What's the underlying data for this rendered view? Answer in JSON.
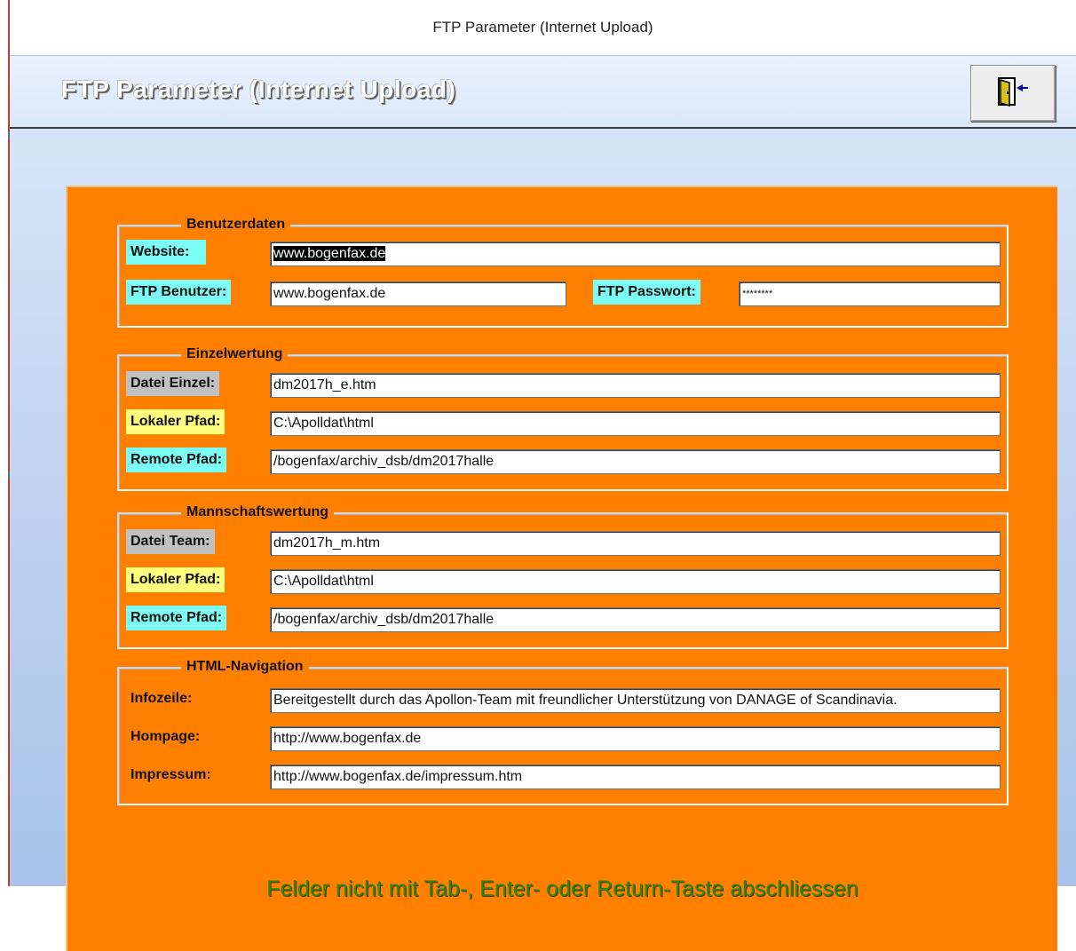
{
  "window": {
    "title": "FTP Parameter (Internet Upload)"
  },
  "header": {
    "title": "FTP Parameter (Internet Upload)",
    "exit_icon": "door-exit-icon"
  },
  "colors": {
    "panel": "#ff8000",
    "label_cyan": "#7bfcf4",
    "label_gray": "#c1c1c1",
    "label_yellow": "#ffff7d",
    "notice_text": "#2a8a00"
  },
  "benutzerdaten": {
    "legend": "Benutzerdaten",
    "website_label": "Website:",
    "website_value": "www.bogenfax.de",
    "ftp_user_label": "FTP Benutzer:",
    "ftp_user_value": "www.bogenfax.de",
    "ftp_password_label": "FTP Passwort:",
    "ftp_password_value": "********"
  },
  "einzelwertung": {
    "legend": "Einzelwertung",
    "file_label": "Datei Einzel:",
    "file_value": "dm2017h_e.htm",
    "local_label": "Lokaler Pfad:",
    "local_value": "C:\\Apolldat\\html",
    "remote_label": "Remote Pfad:",
    "remote_value": "/bogenfax/archiv_dsb/dm2017halle"
  },
  "mannschaftswertung": {
    "legend": "Mannschaftswertung",
    "file_label": "Datei Team:",
    "file_value": "dm2017h_m.htm",
    "local_label": "Lokaler Pfad:",
    "local_value": "C:\\Apolldat\\html",
    "remote_label": "Remote Pfad:",
    "remote_value": "/bogenfax/archiv_dsb/dm2017halle"
  },
  "navigation": {
    "legend": "HTML-Navigation",
    "info_label": "Infozeile:",
    "info_value": "Bereitgestellt durch das Apollon-Team mit freundlicher Unterstützung von DANAGE of Scandinavia.",
    "homepage_label": "Hompage:",
    "homepage_value": "http://www.bogenfax.de",
    "impressum_label": "Impressum:",
    "impressum_value": "http://www.bogenfax.de/impressum.htm"
  },
  "notice": "Felder nicht mit Tab-, Enter- oder Return-Taste abschliessen"
}
